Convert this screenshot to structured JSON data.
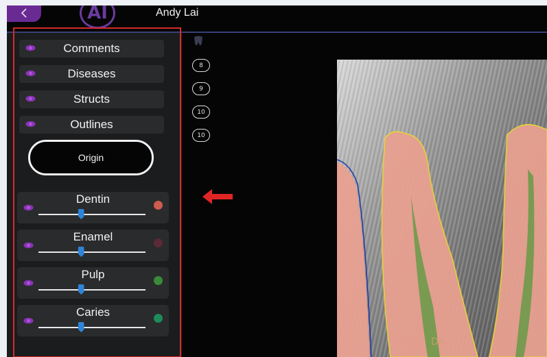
{
  "header": {
    "back_icon": "chevron-left-icon",
    "logo_text": "AI",
    "username": "Andy Lai"
  },
  "toggles": [
    {
      "label": "Comments",
      "icon": "eye-icon"
    },
    {
      "label": "Diseases",
      "icon": "eye-icon"
    },
    {
      "label": "Structs",
      "icon": "eye-icon"
    },
    {
      "label": "Outlines",
      "icon": "eye-icon"
    }
  ],
  "origin_button": {
    "label": "Origin"
  },
  "layers": [
    {
      "label": "Dentin",
      "slider_value": 0.4,
      "color": "#cd5c4f"
    },
    {
      "label": "Enamel",
      "slider_value": 0.4,
      "color": "#5a2a35"
    },
    {
      "label": "Pulp",
      "slider_value": 0.4,
      "color": "#3a8a3a"
    },
    {
      "label": "Caries",
      "slider_value": 0.4,
      "color": "#1f8a5a"
    }
  ],
  "tooth_numbers": [
    "8",
    "9",
    "10",
    "10"
  ],
  "overlay_text": "De",
  "colors": {
    "accent_purple": "#6a2a93",
    "highlight_red": "#d62b2b",
    "slider_blue": "#2e84d8",
    "dentin_fill": "#e8a090",
    "pulp_fill": "#6e9a4a",
    "enamel_outline": "#e8d040",
    "outline_blue": "#2a3aa0"
  }
}
